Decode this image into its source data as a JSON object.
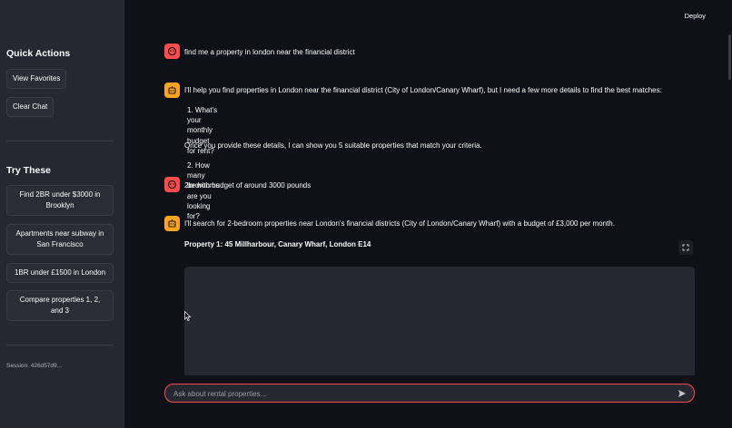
{
  "topbar": {
    "deploy_label": "Deploy"
  },
  "sidebar": {
    "quick_actions_title": "Quick Actions",
    "view_favorites": "View Favorites",
    "clear_chat": "Clear Chat",
    "try_these_title": "Try These",
    "suggestions": [
      "Find 2BR under $3000 in Brooklyn",
      "Apartments near subway in San Francisco",
      "1BR under £1500 in London",
      "Compare properties 1, 2, and 3"
    ],
    "session": "Session: 426d57d9..."
  },
  "chat": {
    "messages": [
      {
        "role": "user",
        "text": "find me a property in london near the financial district"
      },
      {
        "role": "assistant",
        "text": "I'll help you find properties in London near the financial district (City of London/Canary Wharf), but I need a few more details to find the best matches:",
        "list": [
          "1.  What's your monthly budget for rent?",
          "2.  How many bedrooms are you looking for?"
        ],
        "followup": "Once you provide these details, I can show you 5 suitable properties that match your criteria."
      },
      {
        "role": "user",
        "text": "2br with budget of around 3000 pounds"
      },
      {
        "role": "assistant",
        "text": "I'll search for 2-bedroom properties near London's financial districts (City of London/Canary Wharf) with a budget of £3,000 per month.",
        "property_title": "Property 1: 45 Millharbour, Canary Wharf, London E14"
      }
    ]
  },
  "input": {
    "placeholder": "Ask about rental properties..."
  },
  "icons": {
    "user_avatar": "user-face-icon",
    "bot_avatar": "robot-face-icon",
    "send": "send-icon",
    "expand": "fullscreen-icon"
  },
  "colors": {
    "accent": "#ff4b4b",
    "bot": "#ffa421",
    "sidebar_bg": "#262730",
    "main_bg": "#0e1117"
  }
}
